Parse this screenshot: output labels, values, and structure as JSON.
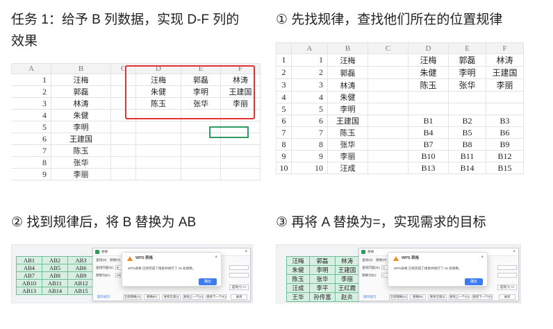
{
  "captions": {
    "task_line1": "任务 1：给予 B 列数据，实现 D-F 列的",
    "task_line2": "效果",
    "step1": "① 先找规律，查找他们所在的位置规律",
    "step2": "② 找到规律后，将 B 替换为 AB",
    "step3": "③ 再将 A 替换为=，实现需求的目标"
  },
  "sheet1": {
    "columns": [
      "A",
      "B",
      "C",
      "D",
      "E",
      "F"
    ],
    "rows": [
      {
        "num": "1",
        "b": "汪梅",
        "d": "汪梅",
        "e": "郭磊",
        "f": "林涛"
      },
      {
        "num": "2",
        "b": "郭磊",
        "d": "朱健",
        "e": "李明",
        "f": "王建国"
      },
      {
        "num": "3",
        "b": "林涛",
        "d": "陈玉",
        "e": "张华",
        "f": "李丽"
      },
      {
        "num": "4",
        "b": "朱健",
        "d": "",
        "e": "",
        "f": ""
      },
      {
        "num": "5",
        "b": "李明",
        "d": "",
        "e": "",
        "f": ""
      },
      {
        "num": "6",
        "b": "王建国",
        "d": "",
        "e": "",
        "f": ""
      },
      {
        "num": "7",
        "b": "陈玉",
        "d": "",
        "e": "",
        "f": ""
      },
      {
        "num": "8",
        "b": "张华",
        "d": "",
        "e": "",
        "f": ""
      },
      {
        "num": "9",
        "b": "李丽",
        "d": "",
        "e": "",
        "f": ""
      }
    ]
  },
  "sheet2": {
    "columns": [
      "",
      "A",
      "B",
      "C",
      "D",
      "E",
      "F"
    ],
    "rows": [
      {
        "num": "1",
        "a": "1",
        "b": "汪梅",
        "d": "汪梅",
        "e": "郭磊",
        "f": "林涛"
      },
      {
        "num": "2",
        "a": "2",
        "b": "郭磊",
        "d": "朱健",
        "e": "李明",
        "f": "王建国"
      },
      {
        "num": "3",
        "a": "3",
        "b": "林涛",
        "d": "陈玉",
        "e": "张华",
        "f": "李丽"
      },
      {
        "num": "4",
        "a": "4",
        "b": "朱健",
        "d": "",
        "e": "",
        "f": ""
      },
      {
        "num": "5",
        "a": "5",
        "b": "李明",
        "d": "",
        "e": "",
        "f": ""
      },
      {
        "num": "6",
        "a": "6",
        "b": "王建国",
        "d": "B1",
        "e": "B2",
        "f": "B3"
      },
      {
        "num": "7",
        "a": "7",
        "b": "陈玉",
        "d": "B4",
        "e": "B5",
        "f": "B6"
      },
      {
        "num": "8",
        "a": "8",
        "b": "张华",
        "d": "B7",
        "e": "B8",
        "f": "B9"
      },
      {
        "num": "9",
        "a": "9",
        "b": "李丽",
        "d": "B10",
        "e": "B11",
        "f": "B12"
      },
      {
        "num": "10",
        "a": "10",
        "b": "汪成",
        "d": "B13",
        "e": "B14",
        "f": "B15"
      }
    ]
  },
  "shot1": {
    "grid": [
      [
        "AB1",
        "AB2",
        "AB3"
      ],
      [
        "AB4",
        "AB5",
        "AB6"
      ],
      [
        "AB7",
        "AB8",
        "AB9"
      ],
      [
        "AB10",
        "AB11",
        "AB12"
      ],
      [
        "AB13",
        "AB14",
        "AB15"
      ]
    ]
  },
  "shot2": {
    "grid": [
      [
        "汪梅",
        "郭磊",
        "林涛"
      ],
      [
        "朱健",
        "李明",
        "王建国"
      ],
      [
        "陈玉",
        "张华",
        "李丽"
      ],
      [
        "汪成",
        "李平",
        "王红霞"
      ],
      [
        "王华",
        "孙传富",
        "赵炎"
      ]
    ]
  },
  "dialog": {
    "title": "替换",
    "tab_find": "查找(D)",
    "tab_replace": "替换(P)",
    "find_label": "查找内容(N):",
    "replace_label": "替换为(E):",
    "find_value_1": "B",
    "replace_value_1": "AB",
    "find_value_2": "A",
    "replace_value_2": "=",
    "options_btn": "选项(T) >>",
    "tips": "操作技巧",
    "btn_replace_all": "全部替换(A)",
    "btn_replace": "替换(R)",
    "btn_find_all": "查找全部(I)",
    "btn_find_prev": "查找上一个(V)",
    "btn_find_next": "查找下一个(F)",
    "btn_close": "关闭"
  },
  "alert": {
    "title": "WPS 表格",
    "message": "WPS表格 已经完成了搜索并进行了 15 处替换。",
    "ok": "确定"
  },
  "colors": {
    "red_outline": "#e5312f",
    "green_selection": "#2e9b62",
    "ok_button": "#3d7cf0",
    "warning": "#f08a1e"
  }
}
